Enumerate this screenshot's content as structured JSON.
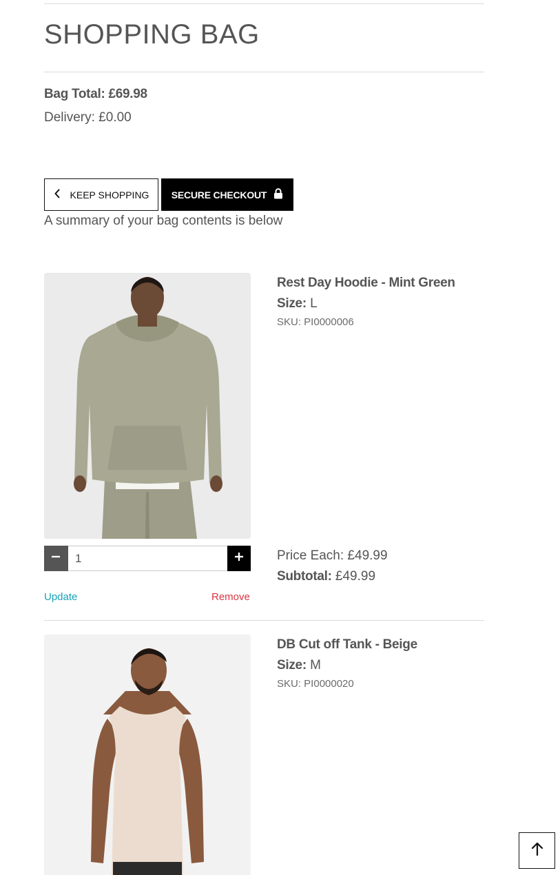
{
  "page": {
    "title": "SHOPPING BAG",
    "bag_total": "Bag Total: £69.98",
    "delivery": "Delivery: £0.00",
    "summary_text": "A summary of your bag contents is below"
  },
  "actions": {
    "keep_shopping_label": "KEEP SHOPPING",
    "checkout_label": "SECURE CHECKOUT"
  },
  "items": [
    {
      "name": "Rest Day Hoodie - Mint Green",
      "size_label": "Size:",
      "size_value": "L",
      "sku": "SKU: PI0000006",
      "quantity": "1",
      "update_label": "Update",
      "remove_label": "Remove",
      "price_each": "Price Each: £49.99",
      "subtotal_label": "Subtotal:",
      "subtotal_value": "£49.99",
      "product_color": "#a8a893"
    },
    {
      "name": "DB Cut off Tank - Beige",
      "size_label": "Size:",
      "size_value": "M",
      "sku": "SKU: PI0000020",
      "product_color": "#ecdccf"
    }
  ],
  "icons": {
    "keep_shopping": "chevron-left-icon",
    "checkout": "lock-icon",
    "qty_minus": "minus-icon",
    "qty_plus": "plus-icon",
    "back_to_top": "arrow-up-icon"
  },
  "colors": {
    "update_link": "#17a2b8",
    "remove_link": "#dc3545",
    "checkout_bg": "#000000"
  }
}
